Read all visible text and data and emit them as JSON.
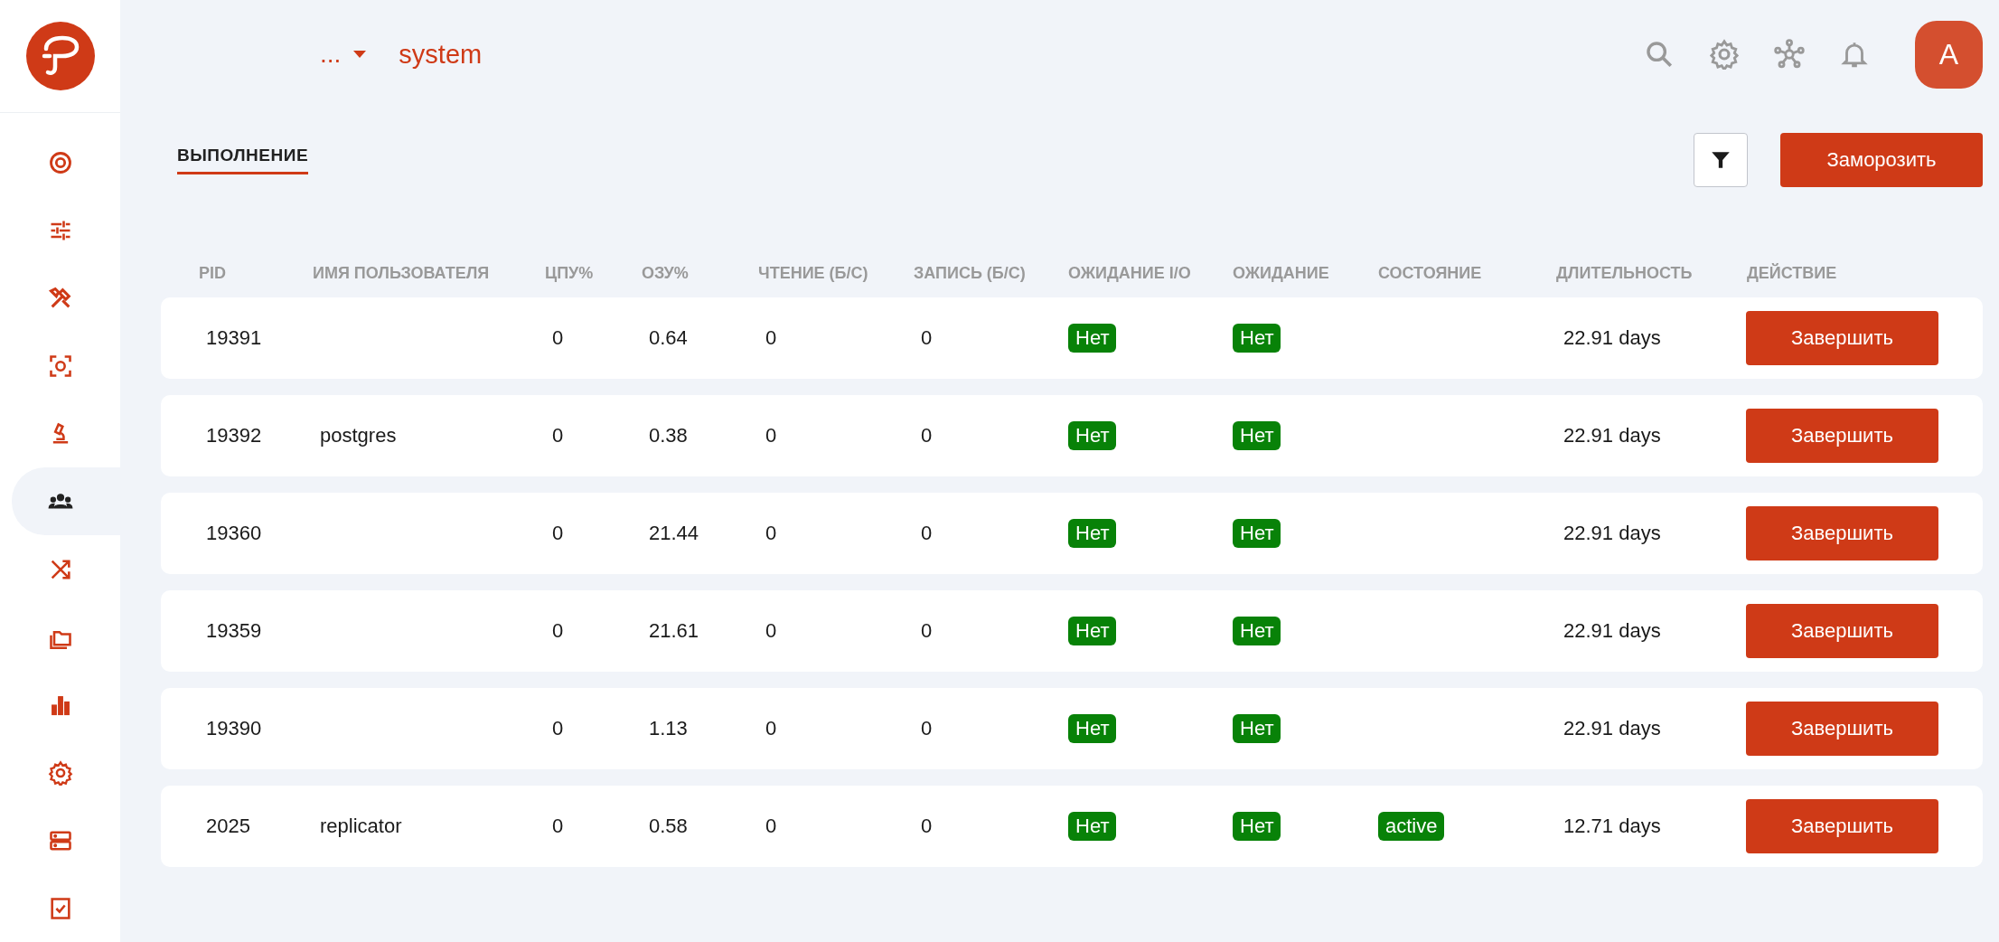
{
  "sidebar": {
    "items": [
      {
        "selected": false
      },
      {
        "selected": false
      },
      {
        "selected": false
      },
      {
        "selected": false
      },
      {
        "selected": false
      },
      {
        "selected": true
      },
      {
        "selected": false
      },
      {
        "selected": false
      },
      {
        "selected": false
      },
      {
        "selected": false
      },
      {
        "selected": false
      },
      {
        "selected": false
      }
    ]
  },
  "header": {
    "breadcrumb_more": "...",
    "title": "system",
    "avatar": "A"
  },
  "tabs": [
    {
      "label": "ВЫПОЛНЕНИЕ",
      "selected": true
    }
  ],
  "toolbar": {
    "freeze_button": "Заморозить"
  },
  "table": {
    "columns": [
      "PID",
      "ИМЯ ПОЛЬЗОВАТЕЛЯ",
      "ЦПУ%",
      "ОЗУ%",
      "ЧТЕНИЕ (Б/С)",
      "ЗАПИСЬ (Б/С)",
      "ОЖИДАНИЕ I/O",
      "ОЖИДАНИЕ",
      "СОСТОЯНИЕ",
      "ДЛИТЕЛЬНОСТЬ",
      "ДЕЙСТВИЕ"
    ],
    "rows": [
      {
        "pid": "19391",
        "user": "",
        "cpu": "0",
        "ram": "0.64",
        "read": "0",
        "write": "0",
        "io_wait": "Нет",
        "wait": "Нет",
        "state": "",
        "duration": "22.91 days",
        "action": "Завершить"
      },
      {
        "pid": "19392",
        "user": "postgres",
        "cpu": "0",
        "ram": "0.38",
        "read": "0",
        "write": "0",
        "io_wait": "Нет",
        "wait": "Нет",
        "state": "",
        "duration": "22.91 days",
        "action": "Завершить"
      },
      {
        "pid": "19360",
        "user": "",
        "cpu": "0",
        "ram": "21.44",
        "read": "0",
        "write": "0",
        "io_wait": "Нет",
        "wait": "Нет",
        "state": "",
        "duration": "22.91 days",
        "action": "Завершить"
      },
      {
        "pid": "19359",
        "user": "",
        "cpu": "0",
        "ram": "21.61",
        "read": "0",
        "write": "0",
        "io_wait": "Нет",
        "wait": "Нет",
        "state": "",
        "duration": "22.91 days",
        "action": "Завершить"
      },
      {
        "pid": "19390",
        "user": "",
        "cpu": "0",
        "ram": "1.13",
        "read": "0",
        "write": "0",
        "io_wait": "Нет",
        "wait": "Нет",
        "state": "",
        "duration": "22.91 days",
        "action": "Завершить"
      },
      {
        "pid": "2025",
        "user": "replicator",
        "cpu": "0",
        "ram": "0.58",
        "read": "0",
        "write": "0",
        "io_wait": "Нет",
        "wait": "Нет",
        "state": "active",
        "duration": "12.71 days",
        "action": "Завершить"
      }
    ]
  }
}
